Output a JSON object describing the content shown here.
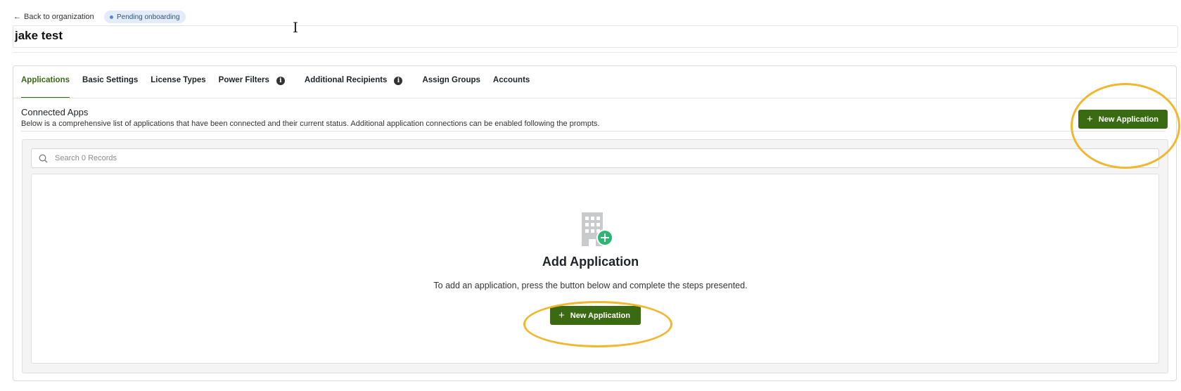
{
  "header": {
    "back_label": "Back to organization",
    "status_badge": "Pending onboarding",
    "title": "jake test"
  },
  "tabs": [
    {
      "label": "Applications",
      "active": true,
      "info": false
    },
    {
      "label": "Basic Settings",
      "active": false,
      "info": false
    },
    {
      "label": "License Types",
      "active": false,
      "info": false
    },
    {
      "label": "Power Filters",
      "active": false,
      "info": true
    },
    {
      "label": "Additional Recipients",
      "active": false,
      "info": true
    },
    {
      "label": "Assign Groups",
      "active": false,
      "info": false
    },
    {
      "label": "Accounts",
      "active": false,
      "info": false
    }
  ],
  "section": {
    "title": "Connected Apps",
    "description": "Below is a comprehensive list of applications that have been connected and their current status. Additional application connections can be enabled following the prompts.",
    "new_button_label": "New Application"
  },
  "search": {
    "placeholder": "Search 0 Records",
    "value": ""
  },
  "empty_state": {
    "title": "Add Application",
    "description": "To add an application, press the button below and complete the steps presented.",
    "button_label": "New Application",
    "icon": "building-plus-icon"
  },
  "colors": {
    "accent": "#3a6b12",
    "highlight": "#f0b72f",
    "badge_bg": "#e3ecfb",
    "empty_icon_plus": "#2bb673"
  }
}
